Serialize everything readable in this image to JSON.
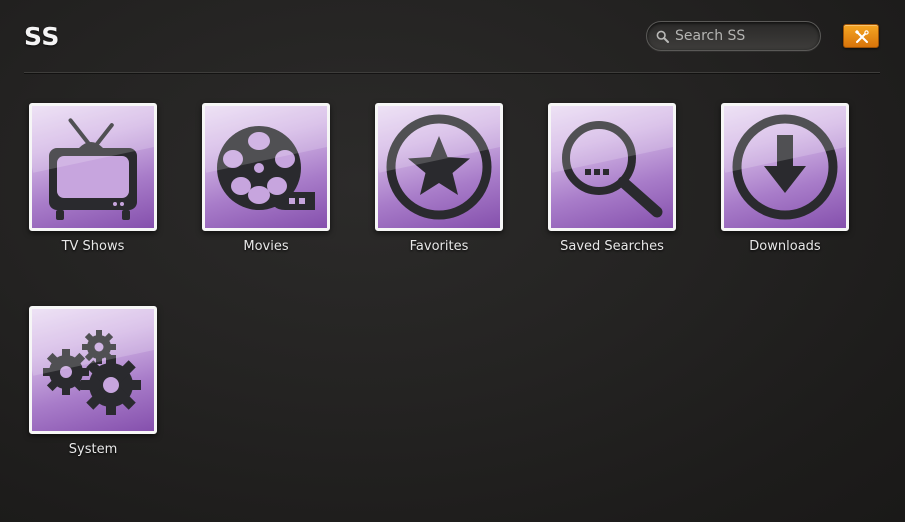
{
  "header": {
    "title": "SS",
    "search_placeholder": "Search SS",
    "search_value": "",
    "search_icon": "magnifier-icon",
    "tools_icon": "wrench-screwdriver-icon",
    "tools_button_color": "#e8890f"
  },
  "tiles": [
    {
      "label": "TV Shows",
      "icon": "tv-icon"
    },
    {
      "label": "Movies",
      "icon": "film-reel-icon"
    },
    {
      "label": "Favorites",
      "icon": "star-icon"
    },
    {
      "label": "Saved Searches",
      "icon": "magnifier-icon"
    },
    {
      "label": "Downloads",
      "icon": "download-arrow-icon"
    },
    {
      "label": "System",
      "icon": "gears-icon"
    }
  ],
  "colors": {
    "tile_gradient_light": "#eadcf3",
    "tile_gradient_dark": "#8550ad",
    "icon_color": "#2a2a2e",
    "background": "#242322"
  }
}
